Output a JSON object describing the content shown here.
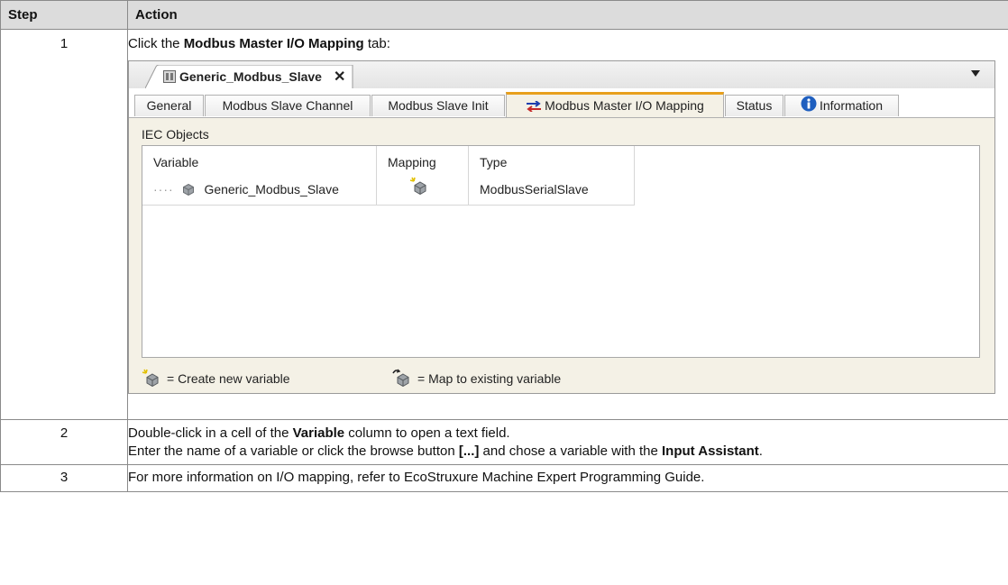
{
  "table": {
    "headers": {
      "step": "Step",
      "action": "Action"
    },
    "rows": [
      {
        "step": "1",
        "text_pre": "Click the ",
        "text_bold": "Modbus Master I/O Mapping",
        "text_post": " tab:"
      },
      {
        "step": "2",
        "line1_pre": "Double-click in a cell of the ",
        "line1_bold": "Variable",
        "line1_post": " column to open a text field.",
        "line2_pre": "Enter the name of a variable or click the browse button ",
        "line2_bold1": "[...]",
        "line2_mid": " and chose a variable with the ",
        "line2_bold2": "Input Assistant",
        "line2_post": "."
      },
      {
        "step": "3",
        "text": "For more information on I/O mapping, refer to EcoStruxure Machine Expert Programming Guide."
      }
    ]
  },
  "screenshot": {
    "document_tab": "Generic_Modbus_Slave",
    "close_glyph": "✕",
    "tabs": [
      {
        "label": "General"
      },
      {
        "label": "Modbus Slave Channel"
      },
      {
        "label": "Modbus Slave Init"
      },
      {
        "label": "Modbus Master I/O Mapping",
        "active": true
      },
      {
        "label": "Status"
      },
      {
        "label": "Information"
      }
    ],
    "section_title": "IEC Objects",
    "columns": {
      "variable": "Variable",
      "mapping": "Mapping",
      "type": "Type"
    },
    "row": {
      "tree_dots": "····",
      "variable": "Generic_Modbus_Slave",
      "type": "ModbusSerialSlave"
    },
    "legend": {
      "create_new": "= Create new variable",
      "map_existing": "= Map to existing variable"
    },
    "colors": {
      "active_tab_accent": "#e8a01c",
      "editor_bg": "#f4f1e6",
      "header_bg": "#dcdcdc"
    }
  }
}
